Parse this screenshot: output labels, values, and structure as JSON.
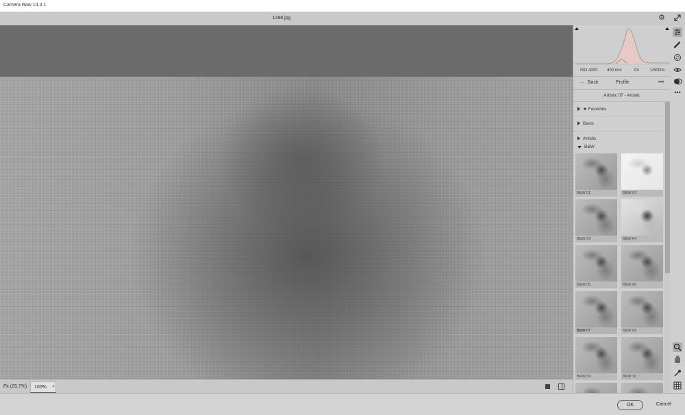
{
  "window": {
    "title": "Camera Raw 14.4.1"
  },
  "file": {
    "name": "1288.jpg"
  },
  "status": {
    "fit_label": "Fit (25.7%)",
    "zoom_value": "100%"
  },
  "histogram": {
    "iso": "ISO 4000",
    "focal": "400 mm",
    "aperture": "f/4",
    "shutter": "1/5000s"
  },
  "profile_panel": {
    "back_label": "Back",
    "title": "Profile",
    "more": "•••",
    "current_profile": "Artistic 07 - Artistic",
    "groups": [
      {
        "label": "Favorites",
        "starred": true,
        "expanded": false
      },
      {
        "label": "Basic",
        "expanded": false
      },
      {
        "label": "Artistic",
        "expanded": false
      },
      {
        "label": "B&W",
        "expanded": true
      }
    ],
    "thumbnails": [
      "B&W 01",
      "B&W 02",
      "B&W 03",
      "B&W 04",
      "B&W 05",
      "B&W 06",
      "B&W 07",
      "B&W 08",
      "B&W 09",
      "B&W 10"
    ],
    "selected_thumbnail": "B&W 07"
  },
  "toolbar": {
    "icons": [
      "edit-sliders-icon",
      "healing-brush-icon",
      "masking-icon",
      "red-eye-icon",
      "presets-icon",
      "more-icon",
      "zoom-icon",
      "hand-icon",
      "color-sampler-icon",
      "grid-icon"
    ],
    "zoom_active": true
  },
  "buttons": {
    "ok": "OK",
    "cancel": "Cancel"
  },
  "colors": {
    "canvas_bg": "#6b6b6b",
    "panel_bg": "#cfcfcf",
    "histogram_fill": "#e8c9c5"
  }
}
